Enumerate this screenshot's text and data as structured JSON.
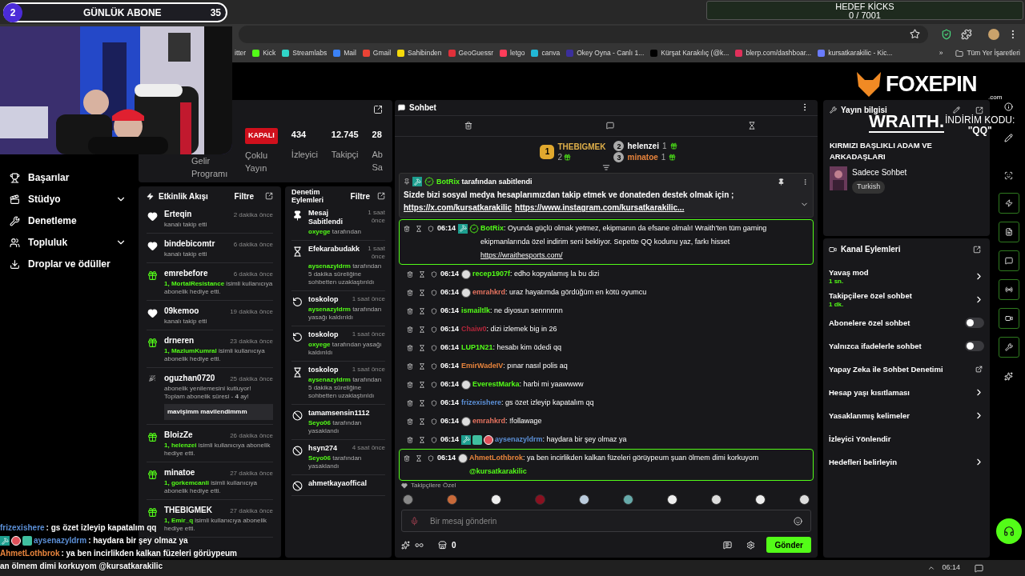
{
  "overlays": {
    "daily_subs": {
      "rank": "2",
      "label": "GÜNLÜK ABONE",
      "count": "35"
    },
    "kick_goal": {
      "title": "HEDEF KİCKS",
      "value": "0 / 7001",
      "level": 0
    },
    "sponsor_logo": {
      "name": "FOXEPIN",
      "domain": ".com"
    },
    "wraith": {
      "brand": "WRAITH.",
      "code_label": "İNDİRİM KODU:",
      "code": "\"QQ\""
    },
    "chat_lines": [
      {
        "user": "frizexishere",
        "color": "#5b8fd6",
        "text": " : gs özet izleyip kapatalım qq"
      },
      {
        "user": "aysenazyldrm",
        "color": "#5b8fd6",
        "text": " : haydara bir şey olmaz ya",
        "badges": [
          {
            "kind": "mod"
          },
          {
            "kind": "red"
          },
          {
            "kind": "sub"
          }
        ]
      },
      {
        "user": "AhmetLothbrok",
        "color": "#e8843c",
        "text": " : ya ben incirlikden kalkan füzeleri görüypeum"
      },
      {
        "text": "an ölmem dimi korkuyom @kursatkarakilic"
      }
    ]
  },
  "browser": {
    "bookmarks": [
      "itter",
      "Kick",
      "Streamlabs",
      "Mail",
      "Gmail",
      "Sahibinden",
      "GeoGuessr",
      "letgo",
      "canva",
      "Okey Oyna - Canlı 1...",
      "Kürşat Karakılıç (@k...",
      "blerp.com/dashboar...",
      "kursatkarakilic - Kic..."
    ],
    "more": "»",
    "all_bookmarks": "Tüm Yer İşaretleri"
  },
  "sidebar": {
    "items": [
      {
        "label": "Başarılar",
        "expandable": false
      },
      {
        "label": "Stüdyo",
        "expandable": true
      },
      {
        "label": "Denetleme",
        "expandable": false
      },
      {
        "label": "Topluluk",
        "expandable": true
      },
      {
        "label": "Droplar ve ödüller",
        "expandable": false
      }
    ]
  },
  "stats": [
    {
      "kind": "text",
      "label": "Gelir Programı"
    },
    {
      "kind": "badge",
      "badge": "KAPALI",
      "label": "Çoklu Yayın"
    },
    {
      "kind": "number",
      "value": "434",
      "label": "İzleyici"
    },
    {
      "kind": "number",
      "value": "12.745",
      "label": "Takipçi"
    },
    {
      "kind": "number",
      "value": "28",
      "label": "Ab Sa"
    }
  ],
  "activity": {
    "title": "Etkinlik Akışı",
    "filter": "Filtre",
    "items": [
      {
        "kind": "follow",
        "user": "Erteqin",
        "time": "2 dakika önce",
        "text": "kanalı takip etti"
      },
      {
        "kind": "follow",
        "user": "bindebicomtr",
        "time": "6 dakika önce",
        "text": "kanalı takip etti"
      },
      {
        "kind": "gift",
        "user": "emrebefore",
        "time": "6 dakika önce",
        "target": "1, MortalResistance",
        "text": " isimli kullanıcıya abonelik hediye etti."
      },
      {
        "kind": "follow",
        "user": "09kemoo",
        "time": "19 dakika önce",
        "text": "kanalı takip etti"
      },
      {
        "kind": "gift",
        "user": "drneren",
        "time": "23 dakika önce",
        "target": "1, MazlumKumral",
        "text": " isimli kullanıcıya abonelik hediye etti."
      },
      {
        "kind": "resub",
        "user": "oguzhan0720",
        "time": "25 dakika önce",
        "text": "abonelik yenilemesini kutluyor! Toplam abonelik süresi - **4** ay!",
        "message": "mavişimm mavilendimmm"
      },
      {
        "kind": "gift",
        "user": "BloizZe",
        "time": "26 dakika önce",
        "target": "1, helenzei",
        "text": " isimli kullanıcıya abonelik hediye etti."
      },
      {
        "kind": "gift",
        "user": "minatoe",
        "time": "27 dakika önce",
        "target": "1, gorkemcanli",
        "text": " isimli kullanıcıya abonelik hediye etti."
      },
      {
        "kind": "gift",
        "user": "THEBIGMEK",
        "time": "27 dakika önce",
        "target": "1, Emir_q",
        "text": " isimli kullanıcıya abonelik hediye etti."
      }
    ]
  },
  "moderation": {
    "title": "Denetim Eylemleri",
    "filter": "Filtre",
    "items": [
      {
        "kind": "pin",
        "user": "Mesaj Sabitlendi",
        "time": "1 saat önce",
        "actor": "oxyege",
        "text": " tarafından"
      },
      {
        "kind": "timeout",
        "user": "Efekarabudakk",
        "time": "1 saat önce",
        "actor": "aysenazyldrm",
        "text": " tarafından 5 dakika süreliğine sohbetten uzaklaştırıldı"
      },
      {
        "kind": "unban",
        "user": "toskolop",
        "time": "1 saat önce",
        "actor": "aysenazyldrm",
        "text": " tarafından yasağı kaldırıldı"
      },
      {
        "kind": "unban",
        "user": "toskolop",
        "time": "1 saat önce",
        "actor": "oxyege",
        "text": " tarafından yasağı kaldırıldı"
      },
      {
        "kind": "timeout",
        "user": "toskolop",
        "time": "1 saat önce",
        "actor": "aysenazyldrm",
        "text": " tarafından 5 dakika süreliğine sohbetten uzaklaştırıldı"
      },
      {
        "kind": "ban",
        "user": "tamamsensin1112",
        "actor": "Seyo06",
        "text": " tarafından yasaklandı"
      },
      {
        "kind": "ban",
        "user": "hsyn274",
        "time": "4 saat önce",
        "actor": "Seyo06",
        "text": " tarafından yasaklandı"
      },
      {
        "kind": "ban",
        "user": "ahmetkayaoffical"
      }
    ]
  },
  "chat": {
    "title": "Sohbet",
    "leaders": [
      {
        "rank": "1",
        "user": "THEBIGMEK",
        "count": "2",
        "color": "#e0b04a"
      },
      {
        "rank": "2",
        "user": "helenzei",
        "count": "1",
        "color": "#ffffff"
      },
      {
        "rank": "3",
        "user": "minatoe",
        "count": "1",
        "color": "#e8843c"
      }
    ],
    "pinned": {
      "badges": [
        {
          "kind": "mod"
        },
        {
          "kind": "verified"
        }
      ],
      "by": "BotRix",
      "by_text": " tarafından sabitlendi",
      "text": "Sizde bizi sosyal medya hesaplarımızdan takip etmek ve donateden destek olmak için ;",
      "links": [
        "https://x.com/kursatkarakilic",
        "https://www.instagram.com/kursatkarakilic..."
      ]
    },
    "messages": [
      {
        "time": "06:14",
        "user": "BotRix",
        "color": "#53fc18",
        "badges": [
          {
            "kind": "mod"
          },
          {
            "kind": "verified"
          }
        ],
        "text": ": Oyunda güçlü olmak yetmez, ekipmanın da efsane olmalı! Wraith'ten tüm gaming ekipmanlarında özel indirim seni bekliyor. Sepette QQ kodunu yaz, farkı hisset ",
        "link": "https://wraithesports.com/",
        "highlighted": true
      },
      {
        "time": "06:14",
        "user": "recep1907f",
        "color": "#53fc18",
        "badges": [
          {
            "kind": "emote"
          }
        ],
        "text": ": edho kopyalamış la bu dizi",
        "highlighted": false
      },
      {
        "time": "06:14",
        "user": "emrahkrd",
        "color": "#e5735f",
        "badges": [
          {
            "kind": "emote"
          }
        ],
        "text": ": uraz hayatımda gördüğüm en kötü oyumcu",
        "highlighted": false
      },
      {
        "time": "06:14",
        "user": "ismailtlk",
        "color": "#53fc18",
        "text": ": ne diyosun sennnnnn",
        "highlighted": false
      },
      {
        "time": "06:14",
        "user": "Chaiw0",
        "color": "#b3263a",
        "text": ": dizi izlemek big in 26",
        "highlighted": false
      },
      {
        "time": "06:14",
        "user": "LUP1N21",
        "color": "#53fc18",
        "text": ": hesabı kim ödedi qq",
        "highlighted": false
      },
      {
        "time": "06:14",
        "user": "EmirWadeIV",
        "color": "#e8843c",
        "text": ": pınar nasıl polis aq",
        "highlighted": false
      },
      {
        "time": "06:14",
        "user": "EverestMarka",
        "color": "#53fc18",
        "badges": [
          {
            "kind": "emote"
          }
        ],
        "text": ": harbi mi yaawwww",
        "highlighted": false
      },
      {
        "time": "06:14",
        "user": "frizexishere",
        "color": "#5b8fd6",
        "text": ": gs özet izleyip kapatalım qq",
        "highlighted": false
      },
      {
        "time": "06:14",
        "user": "emrahkrd",
        "color": "#e5735f",
        "badges": [
          {
            "kind": "emote"
          }
        ],
        "text": ": !follawage",
        "highlighted": false
      },
      {
        "time": "06:14",
        "user": "aysenazyldrm",
        "color": "#5b8fd6",
        "badges": [
          {
            "kind": "mod"
          },
          {
            "kind": "sub"
          },
          {
            "kind": "red"
          }
        ],
        "text": ": haydara bir şey olmaz ya",
        "highlighted": false
      },
      {
        "time": "06:14",
        "user": "AhmetLothbrok",
        "color": "#e8843c",
        "badges": [
          {
            "kind": "emote"
          }
        ],
        "text": ": ya ben incirlikden kalkan füzeleri görüypeum şuan ölmem dimi korkuyom",
        "mention": "@kursatkarakilic",
        "highlighted": true
      }
    ],
    "emote_section": "Takipçilere Özel",
    "input_placeholder": "Bir mesaj gönderin",
    "points": "0",
    "send": "Gönder"
  },
  "stream_info": {
    "title": "Yayın bilgisi",
    "stream_title": "KIRMIZI BAŞLIKLI ADAM VE ARKADAŞLARI",
    "category": "Sadece Sohbet",
    "tag": "Turkish"
  },
  "channel_actions": {
    "title": "Kanal Eylemleri",
    "items": [
      {
        "kind": "nav",
        "label": "Yavaş mod",
        "value": "1 sn."
      },
      {
        "kind": "nav",
        "label": "Takipçilere özel sohbet",
        "value": "1 dk."
      },
      {
        "kind": "toggle",
        "label": "Abonelere özel sohbet",
        "on": false
      },
      {
        "kind": "toggle",
        "label": "Yalnızca ifadelerle sohbet",
        "on": false
      },
      {
        "kind": "external",
        "label": "Yapay Zeka ile Sohbet Denetimi"
      },
      {
        "kind": "nav",
        "label": "Hesap yaşı kısıtlaması"
      },
      {
        "kind": "nav",
        "label": "Yasaklanmış kelimeler"
      },
      {
        "kind": "plain",
        "label": "İzleyici Yönlendir"
      },
      {
        "kind": "nav",
        "label": "Hedefleri belirleyin"
      }
    ]
  },
  "taskbar": {
    "clock": "06:14"
  }
}
